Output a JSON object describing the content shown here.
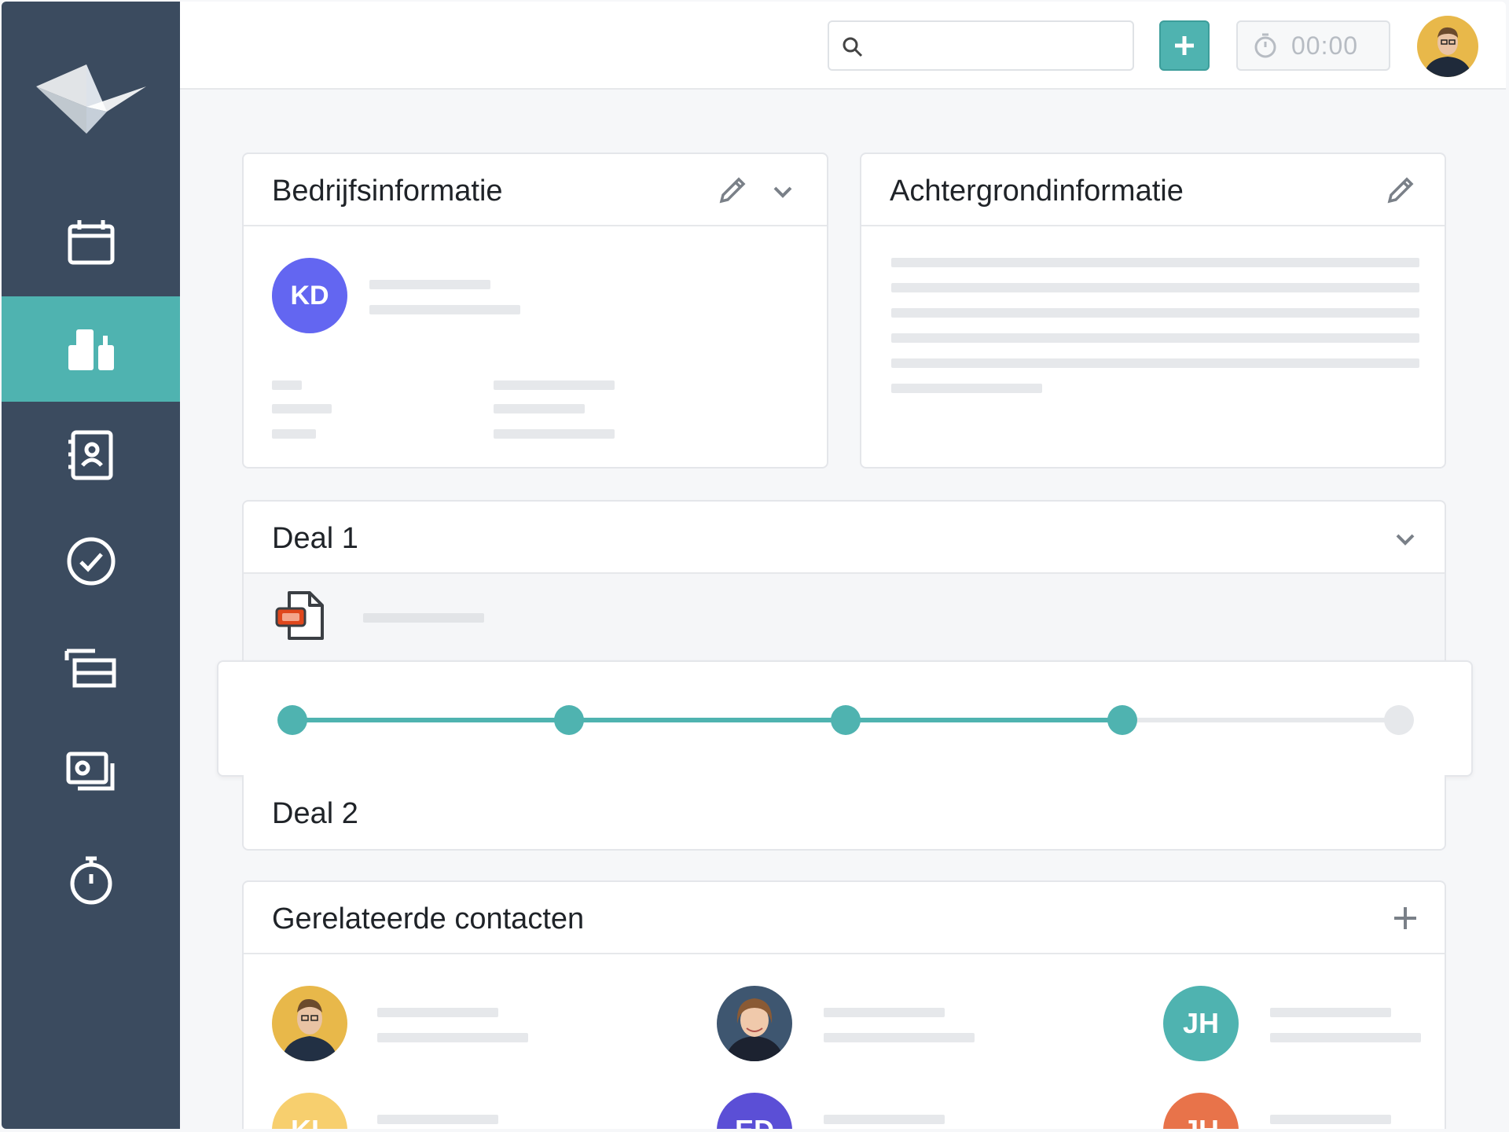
{
  "app": {
    "accent_color": "#4fb3b0",
    "sidebar_color": "#3b4b5f"
  },
  "sidebar": {
    "items": [
      {
        "icon": "calendar-icon",
        "active": false
      },
      {
        "icon": "companies-icon",
        "active": true
      },
      {
        "icon": "contacts-icon",
        "active": false
      },
      {
        "icon": "tasks-check-icon",
        "active": false
      },
      {
        "icon": "stack-icon",
        "active": false
      },
      {
        "icon": "invoices-icon",
        "active": false
      },
      {
        "icon": "stopwatch-icon",
        "active": false
      }
    ]
  },
  "topbar": {
    "search_placeholder": "",
    "add_icon": "plus-icon",
    "timer_value": "00:00"
  },
  "company_card": {
    "title": "Bedrijfsinformatie",
    "initials": "KD",
    "initials_color": "#6366f1"
  },
  "background_card": {
    "title": "Achtergrondinformatie"
  },
  "deal1": {
    "title": "Deal 1",
    "file_icon": "presentation-file-icon",
    "pipeline": {
      "total_stages": 5,
      "completed_stages": 4
    }
  },
  "deal2": {
    "title": "Deal 2"
  },
  "related_contacts": {
    "title": "Gerelateerde contacten",
    "contacts": [
      {
        "type": "photo"
      },
      {
        "type": "photo"
      },
      {
        "type": "initials",
        "initials": "JH",
        "color": "#4fb3b0"
      },
      {
        "type": "initials",
        "initials": "KL",
        "color": "#f7cf6e"
      },
      {
        "type": "initials",
        "initials": "ED",
        "color": "#5b4fd6"
      },
      {
        "type": "initials",
        "initials": "JH",
        "color": "#e8734a"
      }
    ]
  }
}
